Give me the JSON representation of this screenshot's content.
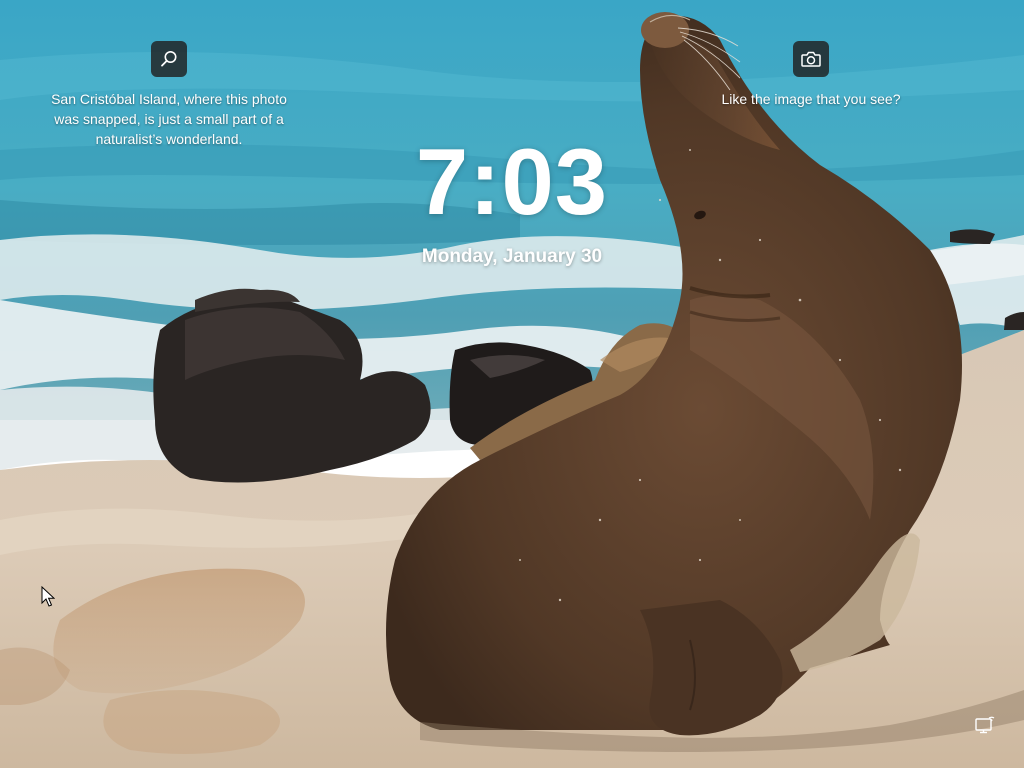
{
  "lock_screen": {
    "time": "7:03",
    "date": "Monday, January 30",
    "spotlight": {
      "search_icon": "search-icon",
      "camera_icon": "camera-icon",
      "caption_left_lines": [
        "San Cristóbal Island, where this photo",
        "was snapped, is just a small part of a",
        "naturalist’s wonderland."
      ],
      "caption_right": "Like the image that you see?"
    },
    "status": {
      "network_icon": "network-icon"
    }
  },
  "wallpaper": {
    "subject": "sea lion on beach",
    "colors": {
      "ocean": "#3d9fb6",
      "ocean_deep": "#2f7f9a",
      "foam": "#dfe6e8",
      "sand": "#dcc9b2",
      "sand_dark": "#b9a087",
      "rock": "#2b2624",
      "sea_lion": "#5b3f2c"
    }
  }
}
